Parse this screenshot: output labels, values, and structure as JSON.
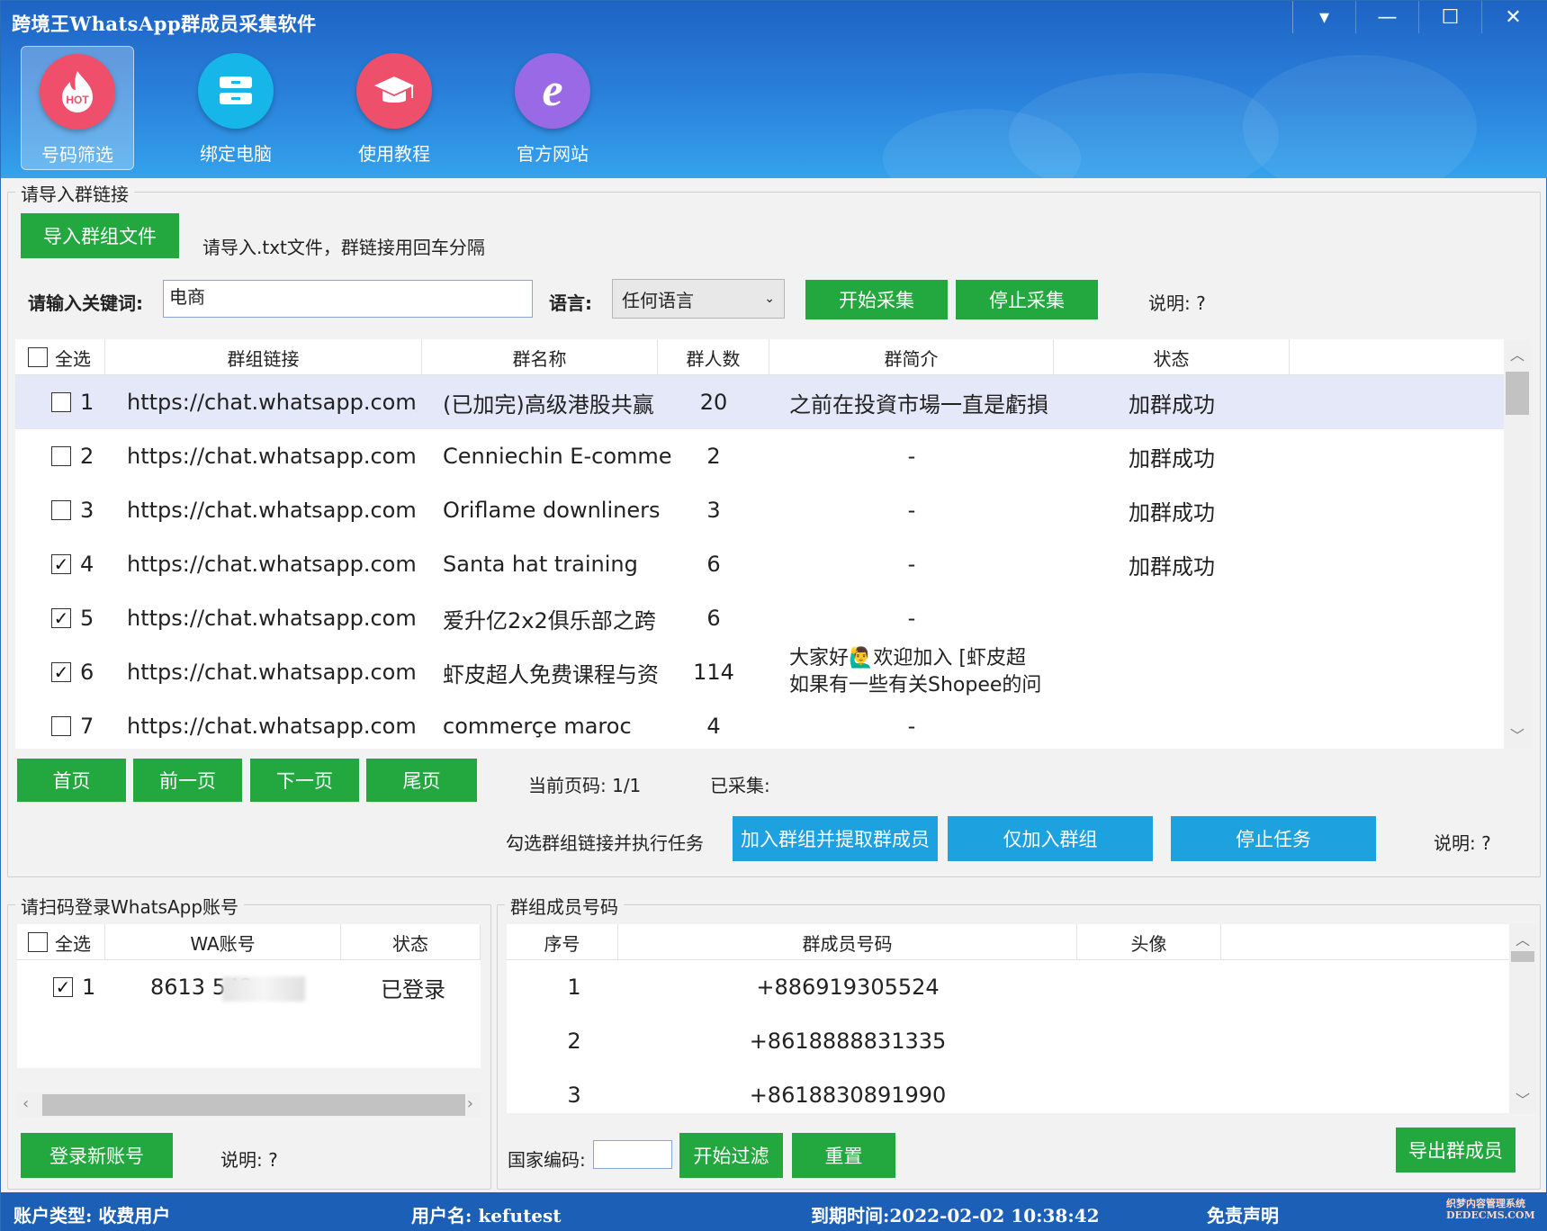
{
  "window": {
    "title": "跨境王WhatsApp群成员采集软件",
    "controls": [
      "▾",
      "—",
      "☐",
      "✕"
    ]
  },
  "nav": [
    {
      "label": "号码筛选",
      "icon": "hot-flame-icon",
      "color": "#ef4f6a",
      "badge": "HOT"
    },
    {
      "label": "绑定电脑",
      "icon": "server-icon",
      "color": "#16b7e8"
    },
    {
      "label": "使用教程",
      "icon": "graduation-cap-icon",
      "color": "#ee4f6b"
    },
    {
      "label": "官方网站",
      "icon": "ie-browser-icon",
      "color": "#9a6ae6"
    }
  ],
  "import_section": {
    "title": "请导入群链接",
    "import_button": "导入群组文件",
    "import_hint": "请导入.txt文件，群链接用回车分隔",
    "keyword_label": "请输入关键词:",
    "keyword_value": "电商",
    "language_label": "语言:",
    "language_value": "任何语言",
    "start_button": "开始采集",
    "stop_button": "停止采集",
    "note": "说明: ?"
  },
  "group_table": {
    "select_all": "全选",
    "columns": [
      "群组链接",
      "群名称",
      "群人数",
      "群简介",
      "状态"
    ],
    "rows": [
      {
        "no": "1",
        "checked": false,
        "link": "https://chat.whatsapp.com/I",
        "name": "(已加完)高级港股共赢",
        "count": "20",
        "intro": "之前在投資市場一直是虧損",
        "intro2": "",
        "status": "加群成功"
      },
      {
        "no": "2",
        "checked": false,
        "link": "https://chat.whatsapp.com/(",
        "name": "Cenniechin E-comme",
        "count": "2",
        "intro": "-",
        "intro2": "",
        "status": "加群成功"
      },
      {
        "no": "3",
        "checked": false,
        "link": "https://chat.whatsapp.com/I",
        "name": "Oriflame downliners",
        "count": "3",
        "intro": "-",
        "intro2": "",
        "status": "加群成功"
      },
      {
        "no": "4",
        "checked": true,
        "link": "https://chat.whatsapp.com/I",
        "name": "Santa hat training",
        "count": "6",
        "intro": "-",
        "intro2": "",
        "status": "加群成功"
      },
      {
        "no": "5",
        "checked": true,
        "link": "https://chat.whatsapp.com/I",
        "name": "爱升亿2x2俱乐部之跨",
        "count": "6",
        "intro": "-",
        "intro2": "",
        "status": ""
      },
      {
        "no": "6",
        "checked": true,
        "link": "https://chat.whatsapp.com/I",
        "name": "虾皮超人免费课程与资",
        "count": "114",
        "intro": "大家好🙋‍♂欢迎加入 [虾皮超",
        "intro2": "如果有一些有关Shopee的问",
        "status": ""
      },
      {
        "no": "7",
        "checked": false,
        "link": "https://chat.whatsapp.com/(",
        "name": "commerçe maroc",
        "count": "4",
        "intro": "-",
        "intro2": "",
        "status": ""
      }
    ]
  },
  "pager": {
    "first": "首页",
    "prev": "前一页",
    "next": "下一页",
    "last": "尾页",
    "current_page": "当前页码:  1/1",
    "collected": "已采集:"
  },
  "task": {
    "hint": "勾选群组链接并执行任务",
    "join_extract": "加入群组并提取群成员",
    "join_only": "仅加入群组",
    "stop": "停止任务",
    "note": "说明: ?"
  },
  "account_section": {
    "title": "请扫码登录WhatsApp账号",
    "select_all": "全选",
    "columns": [
      "WA账号",
      "状态"
    ],
    "rows": [
      {
        "no": "1",
        "checked": true,
        "account": "8613       543",
        "status": "已登录"
      }
    ],
    "login_button": "登录新账号",
    "note": "说明: ?"
  },
  "member_section": {
    "title": "群组成员号码",
    "columns": [
      "序号",
      "群成员号码",
      "头像"
    ],
    "rows": [
      {
        "no": "1",
        "phone": "+886919305524"
      },
      {
        "no": "2",
        "phone": "+8618888831335"
      },
      {
        "no": "3",
        "phone": "+8618830891990"
      }
    ],
    "country_code_label": "国家编码:",
    "country_code_value": "",
    "filter_button": "开始过滤",
    "reset_button": "重置",
    "export_button": "导出群成员"
  },
  "status_bar": {
    "account_type": "账户类型: 收费用户",
    "username": "用户名: kefutest",
    "expire": "到期时间:2022-02-02 10:38:42",
    "disclaimer": "免责声明",
    "watermark": "织梦内容管理系统 DEDECMS.COM"
  },
  "colors": {
    "header_top": "#1e63c4",
    "green_button": "#23a83f",
    "blue_button": "#1ea1df",
    "status_bar": "#1c5fb6",
    "selected_row": "#e5e8f8"
  }
}
